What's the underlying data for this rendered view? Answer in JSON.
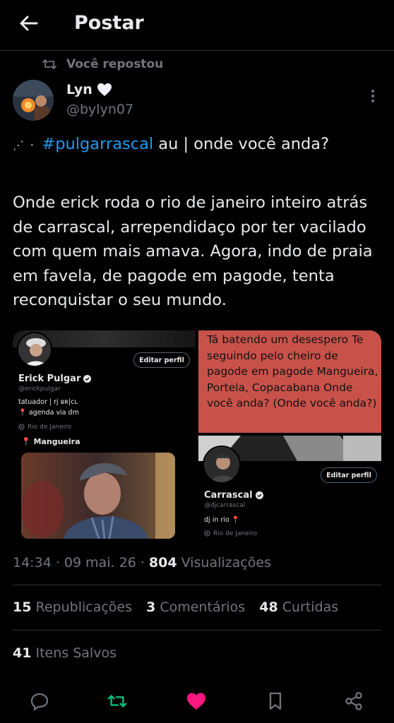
{
  "header": {
    "title": "Postar"
  },
  "repost": {
    "label": "Você repostou"
  },
  "author": {
    "name": "Lyn",
    "handle": "@bylyn07"
  },
  "tweet": {
    "emoji": "⋰ ⸱",
    "hashtag": "#pulgarrascal",
    "line1_rest": " au | onde você anda?",
    "body": "Onde erick roda o rio de janeiro inteiro atrás de carrascal, arrependidaço por ter vacilado com quem mais amava. Agora, indo de praia em favela, de pagode em pagode, tenta reconquistar o seu mundo."
  },
  "media": {
    "profile1": {
      "name": "Erick Pulgar",
      "handle": "@erickpulgar",
      "bio1": "tatuador | rj ʙʀ|ᴄʟ",
      "bio2": "📍 agenda via dm",
      "location": "Rio de Janeiro",
      "pin": "📍 Mangueira",
      "edit": "Editar perfil"
    },
    "lyrics": "Tá batendo um desespero Te seguindo pelo cheiro de pagode em pagode Mangueira, Portela, Copacabana Onde você anda? (Onde você anda?)",
    "profile2": {
      "name": "Carrascal",
      "handle": "@djcarrascal",
      "bio": "dj in rio 📍",
      "location": "Rio de Janeiro",
      "edit": "Editar perfil"
    }
  },
  "meta": {
    "time": "14:34",
    "date": "09 mai. 26",
    "views": "804",
    "views_label": "Visualizações"
  },
  "stats": {
    "reposts": "15",
    "reposts_label": "Republicações",
    "comments": "3",
    "comments_label": "Comentários",
    "likes": "48",
    "likes_label": "Curtidas",
    "saved": "41",
    "saved_label": "Itens Salvos"
  },
  "colors": {
    "accent": "#1d9bf0",
    "repost_green": "#00ba7c",
    "like_pink": "#f91880",
    "lyrics_bg": "#c8524a"
  },
  "icons": [
    "back-arrow-icon",
    "repost-icon",
    "white-heart-icon",
    "more-icon",
    "verified-icon",
    "location-icon",
    "reply-icon",
    "retweet-icon",
    "like-icon",
    "bookmark-icon",
    "share-icon"
  ]
}
